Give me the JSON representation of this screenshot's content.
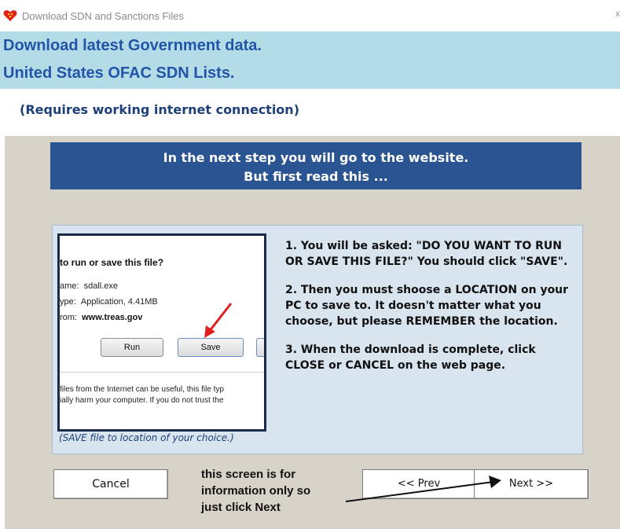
{
  "window": {
    "title": "Download SDN and Sanctions  Files",
    "close_glyph": "x",
    "icon": "heart-app-icon"
  },
  "header": {
    "line1": "Download latest Government data.",
    "line2": "United States OFAC SDN Lists."
  },
  "subheader": "(Requires working internet connection)",
  "banner": {
    "line1": "In the next step you will go to the website.",
    "line2": "But first read this ..."
  },
  "screenshot_example": {
    "title": "to run or save this file?",
    "name_label": "ame:",
    "name_value": "sdall.exe",
    "type_label": "ype:",
    "type_value": "Application, 4.41MB",
    "from_label": "rom:",
    "from_value": "www.treas.gov",
    "run_label": "Run",
    "save_label": "Save",
    "warning_line1": "files from the Internet can be useful, this file typ",
    "warning_line2": "ially harm your computer. If you do not trust the"
  },
  "caption": "(SAVE file to location of your choice.)",
  "instructions": [
    "1.  You will be asked:  \"DO YOU WANT TO RUN OR SAVE THIS FILE?\"  You should click \"SAVE\".",
    "2.  Then you must shoose a LOCATION on your PC to save to.  It doesn't matter what you choose, but please REMEMBER the location.",
    "3.  When the download is complete, click CLOSE or CANCEL on the web page."
  ],
  "buttons": {
    "cancel": "Cancel",
    "prev": "<< Prev",
    "next": "Next >>"
  },
  "note": {
    "line1": "this screen is for",
    "line2": "information only so",
    "line3": "just click Next"
  },
  "colors": {
    "header_bg": "#b4dce6",
    "header_text": "#2255a8",
    "banner_bg": "#2a5492",
    "body_bg": "#d7d3c8",
    "panel_bg": "#d8e4ee",
    "arrow_red": "#e02020"
  }
}
